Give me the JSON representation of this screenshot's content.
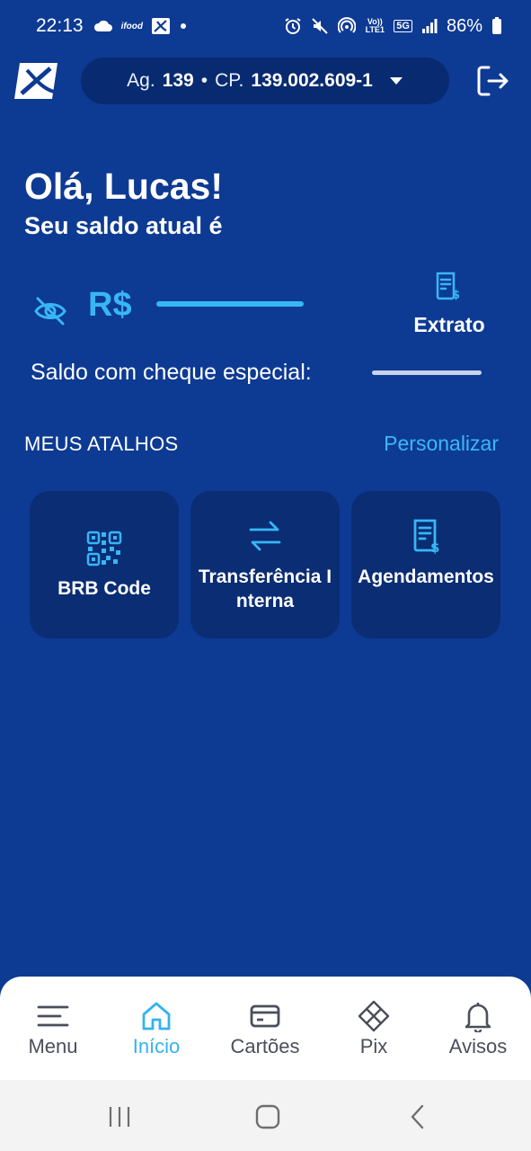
{
  "status_bar": {
    "time": "22:13",
    "battery": "86%",
    "left_icons": [
      "cloud-icon",
      "ifood-icon",
      "brb-icon",
      "dot-icon"
    ],
    "right_icons": [
      "alarm-icon",
      "mute-icon",
      "hotspot-icon",
      "volte-icon",
      "5g-icon",
      "signal-icon",
      "battery-icon"
    ],
    "volte_label": "Vo)) LTE1",
    "network_label": "5G",
    "ifood_label": "ifood"
  },
  "header": {
    "account_prefix": "Ag.",
    "agency": "139",
    "separator": "•",
    "account_type": "CP.",
    "account_number": "139.002.609-1"
  },
  "home": {
    "greeting": "Olá, Lucas!",
    "balance_label": "Seu saldo atual é",
    "currency": "R$",
    "extrato_label": "Extrato",
    "cheque_label": "Saldo com cheque especial:"
  },
  "shortcuts": {
    "title": "MEUS ATALHOS",
    "customize_label": "Personalizar",
    "items": [
      {
        "label": "BRB Code",
        "icon": "qr-code-icon"
      },
      {
        "label": "Transferência Interna",
        "icon": "transfer-arrows-icon"
      },
      {
        "label": "Agendamentos",
        "icon": "receipt-dollar-icon"
      }
    ]
  },
  "bottom_nav": {
    "items": [
      {
        "label": "Menu",
        "icon": "hamburger-icon",
        "active": false
      },
      {
        "label": "Início",
        "icon": "home-icon",
        "active": true
      },
      {
        "label": "Cartões",
        "icon": "card-icon",
        "active": false
      },
      {
        "label": "Pix",
        "icon": "pix-icon",
        "active": false
      },
      {
        "label": "Avisos",
        "icon": "bell-icon",
        "active": false
      }
    ]
  },
  "colors": {
    "background": "#0d3a93",
    "card": "#0a2d74",
    "accent": "#38b6f5",
    "nav_active": "#33b3ee",
    "nav_inactive": "#4a4f5a"
  }
}
